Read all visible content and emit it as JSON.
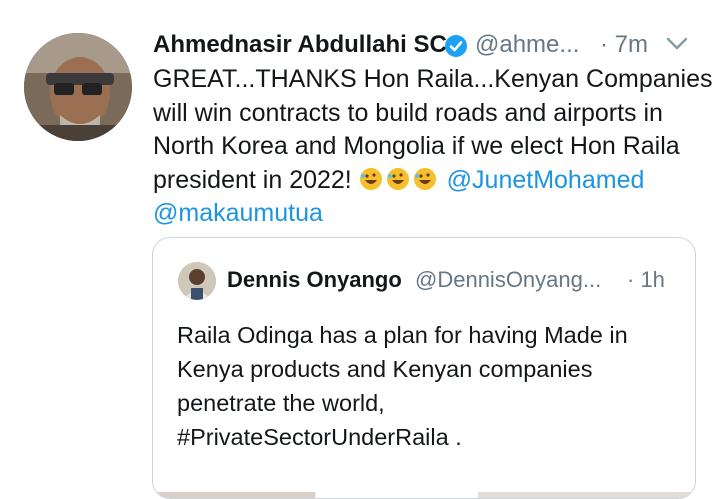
{
  "tweet": {
    "author_name": "Ahmednasir Abdullahi SC",
    "handle": "@ahme...",
    "time": "· 7m",
    "text_lines": [
      "GREAT...THANKS Hon Raila...Kenyan Companies",
      "will win contracts to build roads and airports in",
      "North Korea and Mongolia if we elect Hon Raila",
      "president in 2022!"
    ],
    "emojis": [
      "🤣",
      "🤣",
      "🤣"
    ],
    "mentions": [
      "@JunetMohamed",
      "@makaumutua"
    ],
    "icons": {
      "verified": "verified-badge-icon",
      "menu": "chevron-down-icon"
    }
  },
  "quoted": {
    "author_name": "Dennis Onyango",
    "handle": "@DennisOnyang...",
    "time": "· 1h",
    "text_lines": [
      "Raila Odinga has a plan for having Made in",
      "Kenya products and Kenyan companies",
      "penetrate the world,",
      "#PrivateSectorUnderRaila ."
    ]
  },
  "colors": {
    "link": "#1b95e0",
    "secondary_text": "#657786",
    "border": "#ccd6dd",
    "verified": "#1da1f2"
  }
}
